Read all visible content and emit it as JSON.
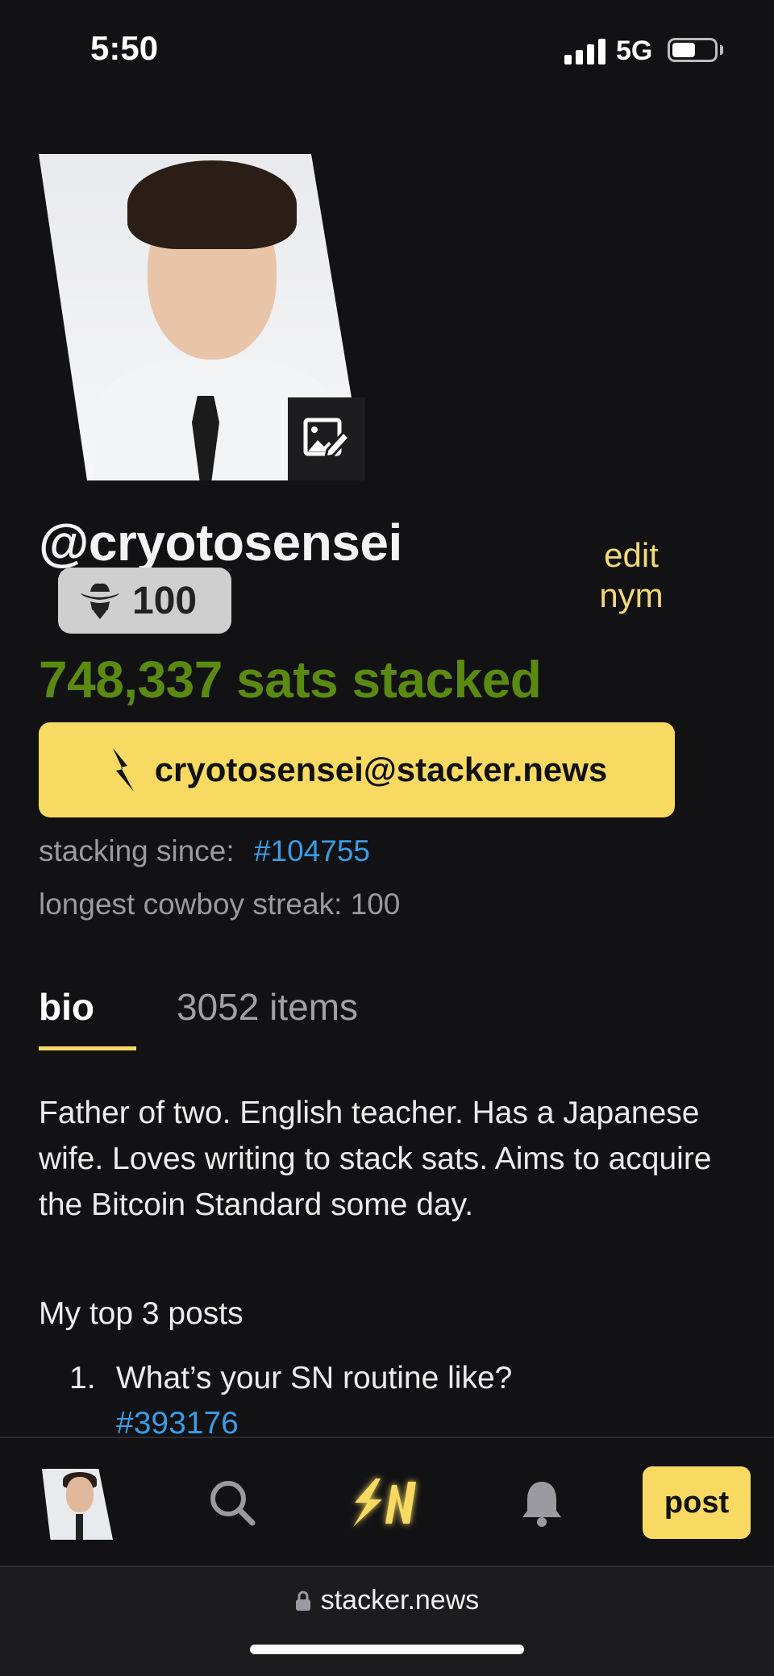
{
  "status_bar": {
    "time": "5:50",
    "network": "5G"
  },
  "profile": {
    "nym": "@cryotosensei",
    "edit_nym_label": "edit nym",
    "cowboy_streak_count": "100",
    "sats_stacked": "748,337 sats stacked",
    "lightning_address": "cryotosensei@stacker.news",
    "stacking_since_label": "stacking since:",
    "stacking_since_item": "#104755",
    "longest_streak": "longest cowboy streak: 100"
  },
  "tabs": [
    {
      "label": "bio",
      "active": true
    },
    {
      "label": "3052 items",
      "active": false
    }
  ],
  "bio": {
    "text": "Father of two. English teacher. Has a Japanese wife. Loves writing to stack sats. Aims to acquire the Bitcoin Standard some day.",
    "top_posts_heading": "My top 3 posts",
    "posts": [
      {
        "number": "1.",
        "title": "What’s your SN routine like?",
        "link": "#393176"
      }
    ]
  },
  "bottom_nav": {
    "items": [
      "avatar",
      "search-icon",
      "sn-logo",
      "bell-icon"
    ],
    "post_label": "post"
  },
  "browser": {
    "url": "stacker.news"
  },
  "colors": {
    "background": "#121214",
    "accent_yellow": "#f8da63",
    "sats_green": "#5a8a12",
    "link_blue": "#3a9ce3"
  }
}
